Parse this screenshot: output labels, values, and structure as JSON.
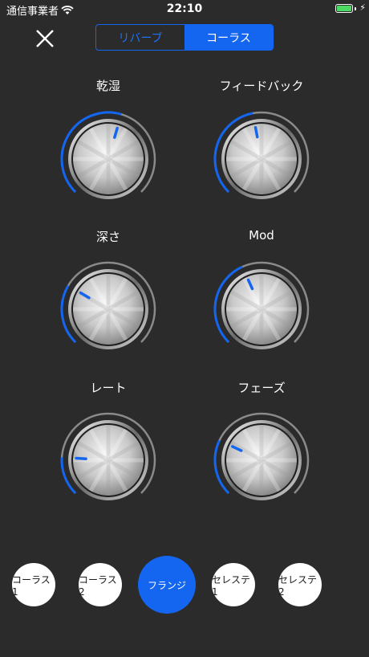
{
  "status_bar": {
    "carrier": "通信事業者",
    "time": "22:10",
    "wifi_icon": "wifi-icon",
    "battery_icon": "battery-icon",
    "charging_icon": "charging-bolt-icon",
    "battery_color": "#4cd964"
  },
  "header": {
    "close_icon": "close-icon",
    "tabs": [
      {
        "label": "リバーブ",
        "selected": false
      },
      {
        "label": "コーラス",
        "selected": true
      }
    ]
  },
  "knobs": [
    {
      "label": "乾湿",
      "value": 0.56
    },
    {
      "label": "フィードバック",
      "value": 0.46
    },
    {
      "label": "深さ",
      "value": 0.28
    },
    {
      "label": "Mod",
      "value": 0.41
    },
    {
      "label": "レート",
      "value": 0.18
    },
    {
      "label": "フェーズ",
      "value": 0.26
    }
  ],
  "presets": [
    {
      "label": "コーラス1",
      "selected": false
    },
    {
      "label": "コーラス2",
      "selected": false
    },
    {
      "label": "フランジ",
      "selected": true
    },
    {
      "label": "セレステ1",
      "selected": false
    },
    {
      "label": "セレステ2",
      "selected": false
    }
  ],
  "colors": {
    "accent": "#1466f0",
    "background": "#2b2b2b",
    "track": "#8a8a8a"
  }
}
